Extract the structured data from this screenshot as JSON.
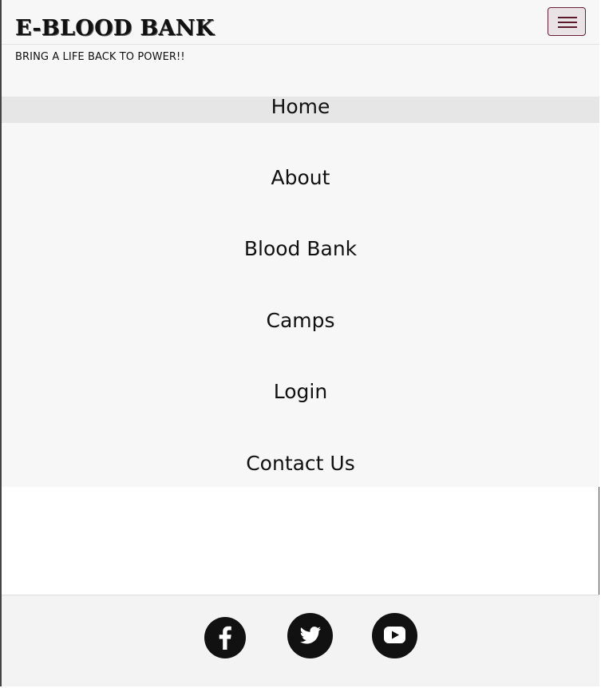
{
  "header": {
    "brand": "E-BLOOD BANK",
    "tagline": "BRING A LIFE BACK TO POWER!!"
  },
  "nav": {
    "items": [
      {
        "label": "Home",
        "active": true
      },
      {
        "label": "About",
        "active": false
      },
      {
        "label": "Blood Bank",
        "active": false
      },
      {
        "label": "Camps",
        "active": false
      },
      {
        "label": "Login",
        "active": false
      },
      {
        "label": "Contact Us",
        "active": false
      }
    ]
  },
  "footer": {
    "social": [
      "facebook-icon",
      "twitter-icon",
      "youtube-icon"
    ]
  },
  "colors": {
    "toggler_border": "#6b2135",
    "toggler_bg": "#e9e3e6",
    "nav_bg": "#f7f7f7",
    "active_bg": "#e6e6e6"
  }
}
